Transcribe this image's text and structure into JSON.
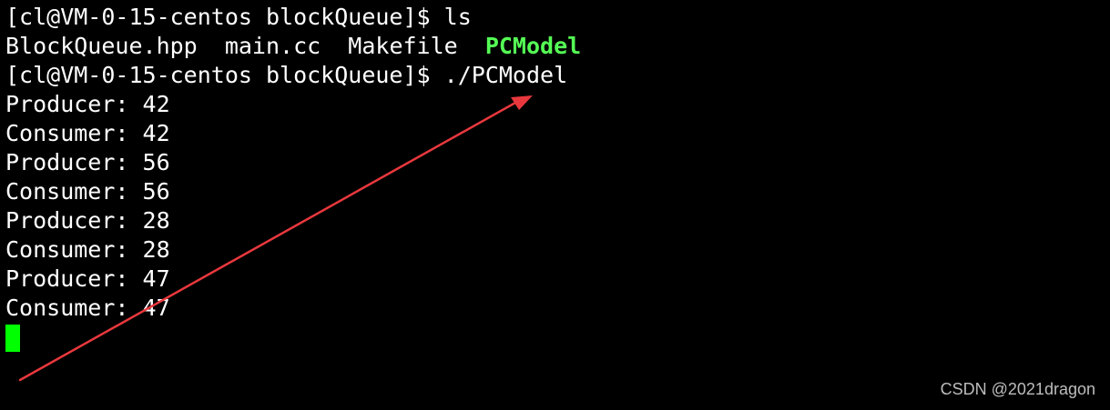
{
  "terminal": {
    "cmd1": {
      "prompt": "[cl@VM-0-15-centos blockQueue]$",
      "command": "ls"
    },
    "ls_output": {
      "file1": "BlockQueue.hpp",
      "file2": "main.cc",
      "file3": "Makefile",
      "executable": "PCModel"
    },
    "cmd2": {
      "prompt": "[cl@VM-0-15-centos blockQueue]$",
      "command": "./PCModel"
    },
    "output_lines": [
      "Producer: 42",
      "Consumer: 42",
      "Producer: 56",
      "Consumer: 56",
      "Producer: 28",
      "Consumer: 28",
      "Producer: 47",
      "Consumer: 47"
    ]
  },
  "colors": {
    "background": "#000000",
    "text": "#ffffff",
    "executable": "#55ff55",
    "cursor": "#00ff00",
    "annotation_arrow": "#e8383d",
    "watermark": "#bdbdbd"
  },
  "watermark": "CSDN @2021dragon"
}
